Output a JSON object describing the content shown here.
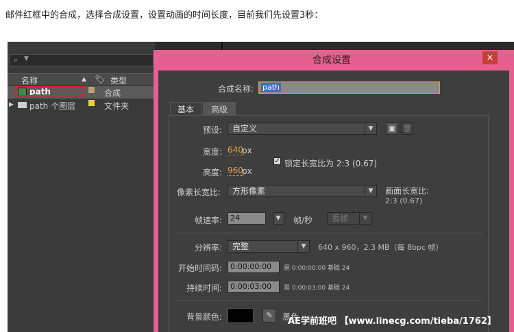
{
  "caption": "邮件红框中的合成，选择合成设置，设置动画的时间长度，目前我们先设置3秒：",
  "project": {
    "col_name": "名称",
    "col_type": "类型",
    "rows": [
      {
        "name": "path",
        "type": "合成",
        "color": "#b8a070"
      },
      {
        "name": "path 个图层",
        "type": "文件夹",
        "color": "#e8d040"
      }
    ]
  },
  "dialog": {
    "title": "合成设置",
    "close_glyph": "×",
    "name_label": "合成名称:",
    "name_value": "path",
    "tabs": [
      "基本",
      "高级"
    ],
    "preset_label": "预设:",
    "preset_value": "自定义",
    "width_label": "宽度:",
    "width_value": "640",
    "width_unit": "px",
    "height_label": "高度:",
    "height_value": "960",
    "height_unit": "px",
    "lock_ratio_label": "锁定长宽比为 2:3 (0.67)",
    "lock_ratio_checked": true,
    "pixel_aspect_label": "像素长宽比:",
    "pixel_aspect_value": "方形像素",
    "frame_aspect_label": "画面长宽比:",
    "frame_aspect_value": "2:3 (0.67)",
    "frame_rate_label": "帧速率:",
    "frame_rate_value": "24",
    "frame_rate_unit": "帧/秒",
    "drop_frame_value": "丢帧",
    "resolution_label": "分辨率:",
    "resolution_value": "完整",
    "resolution_info": "640 x 960，2.3 MB（每 8bpc 帧）",
    "start_tc_label": "开始时间码:",
    "start_tc_value": "0:00:00:00",
    "start_tc_info": "是 0:00:00:00  基础 24",
    "duration_label": "持续时间:",
    "duration_value": "0:00:03:00",
    "duration_info": "是 0:00:03:00  基础 24",
    "bg_color_label": "背景颜色:",
    "bg_color_name": "黑色",
    "bg_color": "#000000"
  },
  "watermark": "AE学前班吧 【www.linecg.com/tieba/1762】"
}
